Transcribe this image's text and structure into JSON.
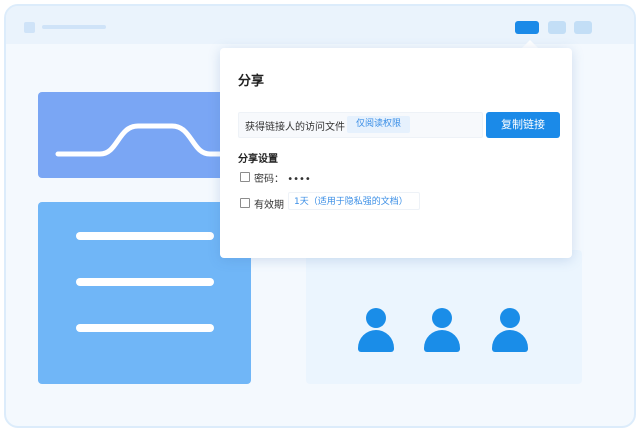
{
  "dialog": {
    "title": "分享",
    "link_text": "获得链接人的访问文件",
    "permission_tag": "仅阅读权限",
    "copy_button": "复制链接",
    "settings_title": "分享设置",
    "password_label": "密码：",
    "password_value": "••••",
    "validity_label": "有效期",
    "validity_value": "1天（适用于隐私强的文档）",
    "password_checked": false,
    "validity_checked": false
  },
  "colors": {
    "accent": "#1b8ae8",
    "card_curve": "#7aa6f4",
    "card_doc": "#70b6f7",
    "background": "#f4f9fe"
  },
  "icons": [
    "user-icon",
    "user-icon",
    "user-icon"
  ]
}
